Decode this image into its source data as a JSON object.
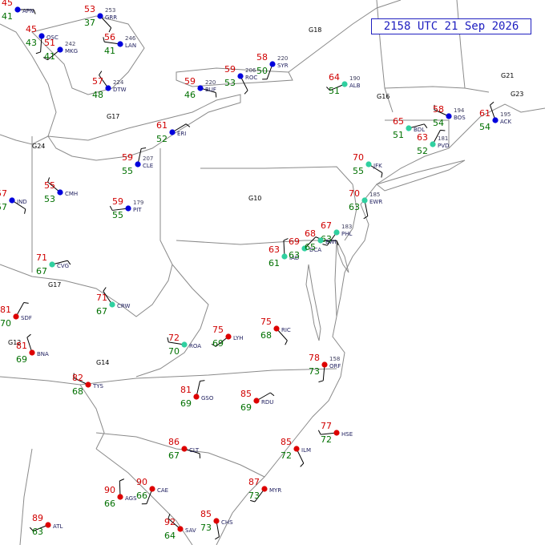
{
  "title": "2158 UTC 21 Sep 2026",
  "colors": {
    "temperature": "#d00000",
    "dewpoint": "#007000",
    "station_id": "#202060",
    "pressure": "#404060",
    "wind_barb": "#000000",
    "boundary": "#707070",
    "station_cool": "#0000dd",
    "station_warm": "#dd0000",
    "station_mild": "#30d0a0",
    "weather_symbol": "#c000c0",
    "title": "#2020c0"
  },
  "stations": [
    {
      "id": "APN",
      "t": "45",
      "td": "41",
      "p": ""
    },
    {
      "id": "GRR",
      "t": "53",
      "td": "37",
      "p": "253"
    },
    {
      "id": "OSC",
      "t": "45",
      "td": "43",
      "p": ""
    },
    {
      "id": "MKG",
      "t": "51",
      "td": "41",
      "p": "242"
    },
    {
      "id": "LAN",
      "t": "56",
      "td": "41",
      "p": "246"
    },
    {
      "id": "DTW",
      "t": "57",
      "td": "48",
      "p": "224"
    },
    {
      "id": "CLE",
      "t": "59",
      "td": "55",
      "p": "207"
    },
    {
      "id": "ERI",
      "t": "61",
      "td": "52",
      "p": ""
    },
    {
      "id": "BUF",
      "t": "59",
      "td": "46",
      "p": "220"
    },
    {
      "id": "ROC",
      "t": "59",
      "td": "53",
      "p": "206"
    },
    {
      "id": "SYR",
      "t": "58",
      "td": "50",
      "p": "220"
    },
    {
      "id": "ALB",
      "t": "64",
      "td": "51",
      "p": "190"
    },
    {
      "id": "BOS",
      "t": "58",
      "td": "54",
      "p": "194"
    },
    {
      "id": "ACK",
      "t": "61",
      "td": "54",
      "p": "195"
    },
    {
      "id": "PVD",
      "t": "63",
      "td": "52",
      "p": "181"
    },
    {
      "id": "BDL",
      "t": "65",
      "td": "51",
      "p": ""
    },
    {
      "id": "JFK",
      "t": "70",
      "td": "55",
      "p": ""
    },
    {
      "id": "EWR",
      "t": "70",
      "td": "63",
      "p": "185"
    },
    {
      "id": "PHL",
      "t": "67",
      "td": "63",
      "p": "183"
    },
    {
      "id": "PIT",
      "t": "59",
      "td": "55",
      "p": "179"
    },
    {
      "id": "CMH",
      "t": "55",
      "td": "53",
      "p": ""
    },
    {
      "id": "IAD",
      "t": "63",
      "td": "61",
      "p": ""
    },
    {
      "id": "DCA",
      "t": "69",
      "td": "63",
      "p": ""
    },
    {
      "id": "BWI",
      "t": "68",
      "td": "65",
      "p": ""
    },
    {
      "id": "RIC",
      "t": "75",
      "td": "68",
      "p": ""
    },
    {
      "id": "ORF",
      "t": "78",
      "td": "73",
      "p": "158"
    },
    {
      "id": "LYH",
      "t": "75",
      "td": "69",
      "p": ""
    },
    {
      "id": "ROA",
      "t": "72",
      "td": "70",
      "p": ""
    },
    {
      "id": "CRW",
      "t": "71",
      "td": "67",
      "p": ""
    },
    {
      "id": "GSO",
      "t": "81",
      "td": "69",
      "p": ""
    },
    {
      "id": "RDU",
      "t": "85",
      "td": "69",
      "p": ""
    },
    {
      "id": "CLT",
      "t": "86",
      "td": "67",
      "p": ""
    },
    {
      "id": "ILM",
      "t": "85",
      "td": "72",
      "p": ""
    },
    {
      "id": "CAE",
      "t": "90",
      "td": "66",
      "p": ""
    },
    {
      "id": "ATL",
      "t": "89",
      "td": "63",
      "p": ""
    },
    {
      "id": "TYS",
      "t": "82",
      "td": "68",
      "p": ""
    },
    {
      "id": "BNA",
      "t": "81",
      "td": "69",
      "p": ""
    },
    {
      "id": "SDF",
      "t": "81",
      "td": "70",
      "p": ""
    },
    {
      "id": "CVG",
      "t": "71",
      "td": "67",
      "p": ""
    },
    {
      "id": "IND",
      "t": "57",
      "td": "57",
      "p": ""
    },
    {
      "id": "CHS",
      "t": "85",
      "td": "73",
      "p": ""
    },
    {
      "id": "MYR",
      "t": "87",
      "td": "73",
      "p": ""
    },
    {
      "id": "HSE",
      "t": "77",
      "td": "72",
      "p": ""
    },
    {
      "id": "SAV",
      "t": "92",
      "td": "64",
      "p": ""
    },
    {
      "id": "AGS",
      "t": "90",
      "td": "66",
      "p": ""
    }
  ],
  "labels": {
    "g18": "G18",
    "g21": "G21",
    "g23": "G23",
    "g16": "G16",
    "g17a": "G17",
    "g17b": "G17",
    "g12": "G12",
    "g14": "G14",
    "g10": "G10",
    "g24": "G24"
  }
}
